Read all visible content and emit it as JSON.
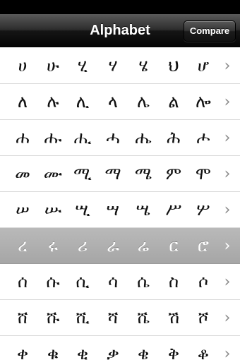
{
  "nav": {
    "title": "Alphabet",
    "compare_label": "Compare"
  },
  "rows": [
    {
      "chars": [
        "ሀ",
        "ሁ",
        "ሂ",
        "ሃ",
        "ሄ",
        "ህ",
        "ሆ"
      ],
      "selected": false
    },
    {
      "chars": [
        "ለ",
        "ሉ",
        "ሊ",
        "ላ",
        "ሌ",
        "ል",
        "ሎ"
      ],
      "selected": false
    },
    {
      "chars": [
        "ሐ",
        "ሑ",
        "ሒ",
        "ሓ",
        "ሔ",
        "ሕ",
        "ሖ"
      ],
      "selected": false
    },
    {
      "chars": [
        "መ",
        "ሙ",
        "ሚ",
        "ማ",
        "ሜ",
        "ም",
        "ሞ"
      ],
      "selected": false
    },
    {
      "chars": [
        "ሠ",
        "ሡ",
        "ሢ",
        "ሣ",
        "ሤ",
        "ሥ",
        "ሦ"
      ],
      "selected": false
    },
    {
      "chars": [
        "ረ",
        "ሩ",
        "ሪ",
        "ራ",
        "ሬ",
        "ር",
        "ሮ"
      ],
      "selected": true
    },
    {
      "chars": [
        "ሰ",
        "ሱ",
        "ሲ",
        "ሳ",
        "ሴ",
        "ስ",
        "ሶ"
      ],
      "selected": false
    },
    {
      "chars": [
        "ሸ",
        "ሹ",
        "ሺ",
        "ሻ",
        "ሼ",
        "ሽ",
        "ሾ"
      ],
      "selected": false
    },
    {
      "chars": [
        "ቀ",
        "ቁ",
        "ቂ",
        "ቃ",
        "ቄ",
        "ቅ",
        "ቆ"
      ],
      "selected": false
    }
  ],
  "icons": {
    "row_disclosure": "chevron-right-icon"
  }
}
